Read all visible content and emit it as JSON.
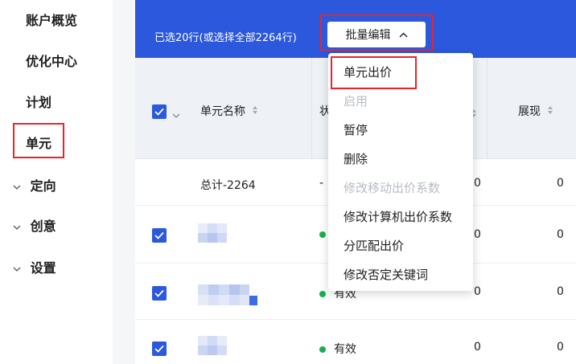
{
  "sidebar": {
    "items": [
      {
        "label": "账户概览"
      },
      {
        "label": "优化中心"
      },
      {
        "label": "计划"
      },
      {
        "label": "单元"
      },
      {
        "label": "定向"
      },
      {
        "label": "创意"
      },
      {
        "label": "设置"
      }
    ]
  },
  "selection": {
    "text": "已选20行(或选择全部2264行)",
    "batch_edit_label": "批量编辑"
  },
  "dropdown": {
    "items": [
      {
        "label": "单元出价",
        "disabled": false
      },
      {
        "label": "启用",
        "disabled": true
      },
      {
        "label": "暂停",
        "disabled": false
      },
      {
        "label": "删除",
        "disabled": false
      },
      {
        "label": "修改移动出价系数",
        "disabled": true
      },
      {
        "label": "修改计算机出价系数",
        "disabled": false
      },
      {
        "label": "分匹配出价",
        "disabled": false
      },
      {
        "label": "修改否定关键词",
        "disabled": false
      }
    ]
  },
  "table": {
    "headers": {
      "name": "单元名称",
      "status_partial": "状",
      "impressions": "展现"
    },
    "total_row": {
      "name": "总计-2264",
      "status": "-",
      "col3": "0",
      "impressions": "0"
    },
    "rows": [
      {
        "status": "",
        "col3": "0",
        "impressions": "0"
      },
      {
        "status": "有效",
        "col3": "0",
        "impressions": "0"
      },
      {
        "status": "有效",
        "col3": "0",
        "impressions": "0"
      }
    ]
  },
  "colors": {
    "primary_blue": "#2b58dd",
    "highlight_red": "#e8242b",
    "status_green": "#16b04e"
  }
}
